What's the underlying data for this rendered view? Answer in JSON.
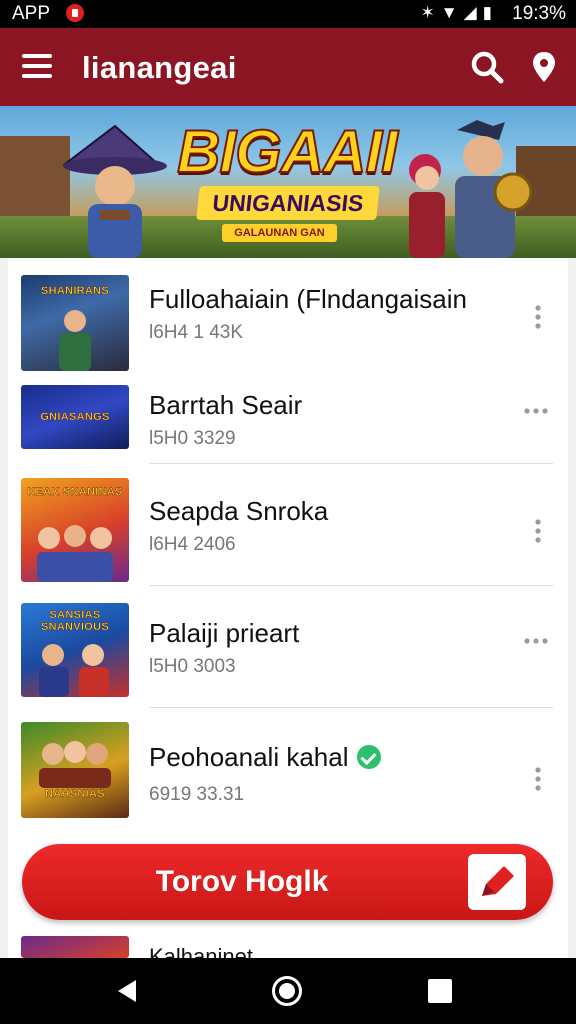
{
  "status_bar": {
    "app_label": "APP",
    "time": "19:3%",
    "icons": [
      "record-icon",
      "vibrate-icon",
      "wifi-icon",
      "signal-icon",
      "battery-icon"
    ]
  },
  "app_bar": {
    "title": "lianangeai",
    "icons": [
      "menu-icon",
      "search-icon",
      "pin-icon"
    ],
    "background_color": "#8b1522"
  },
  "banner": {
    "title": "BIGAAII",
    "subtitle": "UNIGANIASIS",
    "tagline": "GALAUNAN GAN"
  },
  "list": {
    "items": [
      {
        "title": "Fulloahaiain (Flndangaisain",
        "meta": "l6H4 1 43K",
        "thumb_text": "SHANIRANS",
        "menu_icon": "more-vert-icon",
        "verified": false
      },
      {
        "title": "Barrtah Seair",
        "meta": "l5H0 3329",
        "thumb_text": "GNIASANGS",
        "menu_icon": "more-horiz-icon",
        "verified": false
      },
      {
        "title": "Seapda Snroka",
        "meta": "l6H4 2406",
        "thumb_text": "KEAK SNANINAS",
        "menu_icon": "more-vert-icon",
        "verified": false
      },
      {
        "title": "Palaiji prieart",
        "meta": "l5H0 3003",
        "thumb_text": "SANSIAS SNANVIOUS",
        "menu_icon": "more-horiz-icon",
        "verified": false
      },
      {
        "title": "Peohoanali kahal",
        "meta": "6919 33.31",
        "thumb_text": "NAHSNIAS",
        "menu_icon": "more-vert-icon",
        "verified": true
      }
    ],
    "peek_item_title": "Kalhaninet"
  },
  "cta": {
    "label": "Torov Hoglk",
    "icon": "edit-pencil-icon",
    "color": "#e01f1f"
  },
  "nav_bar": {
    "icons": [
      "back-icon",
      "home-icon",
      "recents-icon"
    ]
  }
}
